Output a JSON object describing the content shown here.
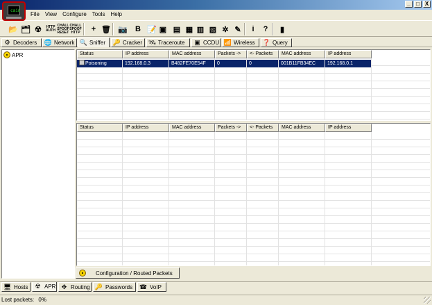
{
  "window": {
    "controls": [
      "_",
      "□",
      "X"
    ]
  },
  "menu": [
    "File",
    "View",
    "Configure",
    "Tools",
    "Help"
  ],
  "toolbar": {
    "items": [
      {
        "name": "open-icon",
        "glyph": "📂"
      },
      {
        "name": "add-network-icon",
        "glyph": "🗂"
      },
      {
        "name": "start-apr-icon",
        "glyph": "☢"
      },
      {
        "name": "http-auth-icon",
        "label_lines": [
          "HTTP",
          "AUTH"
        ]
      },
      {
        "name": "chall-spoof-reset-icon",
        "label_lines": [
          "CHALL",
          "SPOOF",
          "RESET"
        ]
      },
      {
        "name": "chall-spoof-http-icon",
        "label_lines": [
          "CHALL",
          "SPOOF",
          "HTTP"
        ]
      },
      {
        "name": "add-icon",
        "glyph": "+"
      },
      {
        "name": "remove-icon",
        "glyph": "🗑"
      },
      {
        "name": "snapshot-icon",
        "glyph": "📷"
      },
      {
        "name": "base64-icon",
        "glyph": "B"
      },
      {
        "name": "notes-icon",
        "glyph": "📝"
      },
      {
        "name": "asl-icon",
        "glyph": "▣"
      },
      {
        "name": "lsa-icon",
        "glyph": "▤"
      },
      {
        "name": "dos-icon",
        "glyph": "▦"
      },
      {
        "name": "console-icon",
        "glyph": "▥"
      },
      {
        "name": "router-icon",
        "glyph": "▧"
      },
      {
        "name": "network-icon",
        "glyph": "✲"
      },
      {
        "name": "wizard-icon",
        "glyph": "✎"
      },
      {
        "name": "info-icon",
        "glyph": "i"
      },
      {
        "name": "help-icon",
        "glyph": "?"
      },
      {
        "name": "exit-icon",
        "glyph": "▮"
      }
    ]
  },
  "tabs_top": [
    {
      "label": "Decoders",
      "icon": "decoders-icon",
      "glyph": "⚙"
    },
    {
      "label": "Network",
      "icon": "network-icon",
      "glyph": "🌐"
    },
    {
      "label": "Sniffer",
      "icon": "sniffer-icon",
      "glyph": "🔍"
    },
    {
      "label": "Cracker",
      "icon": "cracker-icon",
      "glyph": "🔑"
    },
    {
      "label": "Traceroute",
      "icon": "traceroute-icon",
      "glyph": "🛰"
    },
    {
      "label": "CCDU",
      "icon": "ccdu-icon",
      "glyph": "▣"
    },
    {
      "label": "Wireless",
      "icon": "wireless-icon",
      "glyph": "📶"
    },
    {
      "label": "Query",
      "icon": "query-icon",
      "glyph": "❓"
    }
  ],
  "tree": {
    "item": "APR"
  },
  "upper_grid": {
    "columns": [
      "Status",
      "IP address",
      "MAC address",
      "Packets ->",
      "<- Packets",
      "MAC address",
      "IP address"
    ],
    "rows": [
      [
        "Poisoning",
        "192.168.0.3",
        "B482FE70E54F",
        "0",
        "0",
        "001B11FB34EC",
        "192.168.0.1"
      ]
    ]
  },
  "lower_grid": {
    "columns": [
      "Status",
      "IP address",
      "MAC address",
      "Packets ->",
      "<- Packets",
      "MAC address",
      "IP address"
    ]
  },
  "inner_tab": "Configuration / Routed Packets",
  "tabs_bottom": [
    {
      "label": "Hosts",
      "icon": "hosts-icon",
      "glyph": "🖥"
    },
    {
      "label": "APR",
      "icon": "apr-icon",
      "glyph": "☢"
    },
    {
      "label": "Routing",
      "icon": "routing-icon",
      "glyph": "✥"
    },
    {
      "label": "Passwords",
      "icon": "passwords-icon",
      "glyph": "🔑"
    },
    {
      "label": "VoIP",
      "icon": "voip-icon",
      "glyph": "☎"
    }
  ],
  "status": {
    "label": "Lost packets:",
    "value": "0%"
  }
}
